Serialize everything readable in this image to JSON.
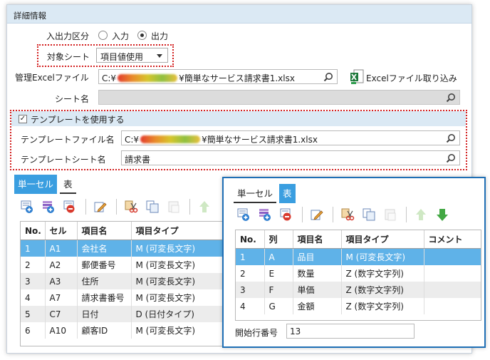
{
  "section_title": "詳細情報",
  "io": {
    "label": "入出力区分",
    "options": [
      "入力",
      "出力"
    ],
    "selected": "出力"
  },
  "target_sheet": {
    "label": "対象シート",
    "value": "項目値使用"
  },
  "excel": {
    "label": "管理Excelファイル",
    "path_prefix": "C:¥",
    "path_suffix": "¥簡単なサービス請求書1.xlsx",
    "import_label": "Excelファイル取り込み"
  },
  "sheet_name": {
    "label": "シート名",
    "value": ""
  },
  "template": {
    "checkbox_label": "テンプレートを使用する",
    "checked": true,
    "file_label": "テンプレートファイル名",
    "file_prefix": "C:¥",
    "file_suffix": "¥簡単なサービス請求書1.xlsx",
    "sheet_label": "テンプレートシート名",
    "sheet_value": "請求書"
  },
  "main_tabs": [
    "単一セル",
    "表"
  ],
  "main_grid": {
    "headers": [
      "No.",
      "セル",
      "項目名",
      "項目タイプ"
    ],
    "rows": [
      [
        "1",
        "A1",
        "会社名",
        "M (可変長文字)"
      ],
      [
        "2",
        "A2",
        "郵便番号",
        "M (可変長文字)"
      ],
      [
        "3",
        "A3",
        "住所",
        "M (可変長文字)"
      ],
      [
        "4",
        "A7",
        "請求書番号",
        "M (可変長文字)"
      ],
      [
        "5",
        "C7",
        "日付",
        "D (日付タイプ)"
      ],
      [
        "6",
        "A10",
        "顧客ID",
        "M (可変長文字)"
      ]
    ]
  },
  "popup": {
    "tabs": [
      "単一セル",
      "表"
    ],
    "headers": [
      "No.",
      "列",
      "項目名",
      "項目タイプ",
      "コメント"
    ],
    "rows": [
      [
        "1",
        "A",
        "品目",
        "M (可変長文字)",
        ""
      ],
      [
        "2",
        "E",
        "数量",
        "Z (数字文字列)",
        ""
      ],
      [
        "3",
        "F",
        "単価",
        "Z (数字文字列)",
        ""
      ],
      [
        "4",
        "G",
        "金額",
        "Z (数字文字列)",
        ""
      ]
    ],
    "start_row_label": "開始行番号",
    "start_row_value": "13"
  },
  "colors": {
    "header_bg": "#dbe9f4",
    "selection": "#5fb2e8",
    "tab_active": "#3a9ee0",
    "highlight": "#d32020",
    "popup_border": "#1f6fb5"
  }
}
